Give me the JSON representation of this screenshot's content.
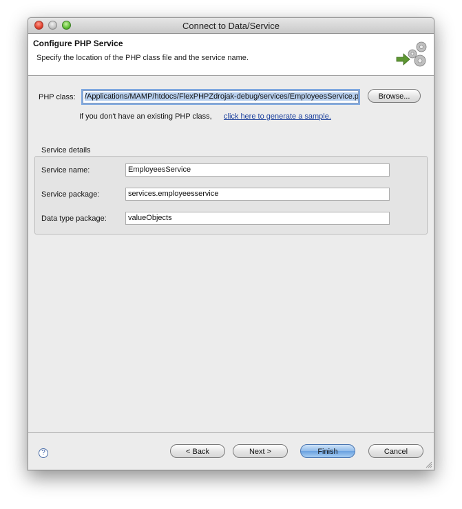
{
  "window": {
    "title": "Connect to Data/Service"
  },
  "header": {
    "title": "Configure PHP Service",
    "description": "Specify the location of the PHP class file and the service name."
  },
  "php_class": {
    "label": "PHP class:",
    "value": "/Applications/MAMP/htdocs/FlexPHPZdrojak-debug/services/EmployeesService.php",
    "browse_label": "Browse...",
    "hint_text": "If you don't have an existing PHP class,",
    "hint_link": "click here to generate a sample."
  },
  "service_details": {
    "group_label": "Service details",
    "service_name_label": "Service name:",
    "service_name_value": "EmployeesService",
    "service_package_label": "Service package:",
    "service_package_value": "services.employeesservice",
    "data_type_package_label": "Data type package:",
    "data_type_package_value": "valueObjects"
  },
  "footer": {
    "help_icon": "?",
    "back_label": "< Back",
    "next_label": "Next >",
    "finish_label": "Finish",
    "cancel_label": "Cancel"
  },
  "colors": {
    "accent": "#6aa1e0",
    "link": "#1a3f9c",
    "arrow_green": "#5d9632"
  },
  "icons": [
    "close-icon",
    "minimize-icon",
    "zoom-icon",
    "service-gears-icon",
    "help-icon",
    "resize-grip-icon"
  ]
}
